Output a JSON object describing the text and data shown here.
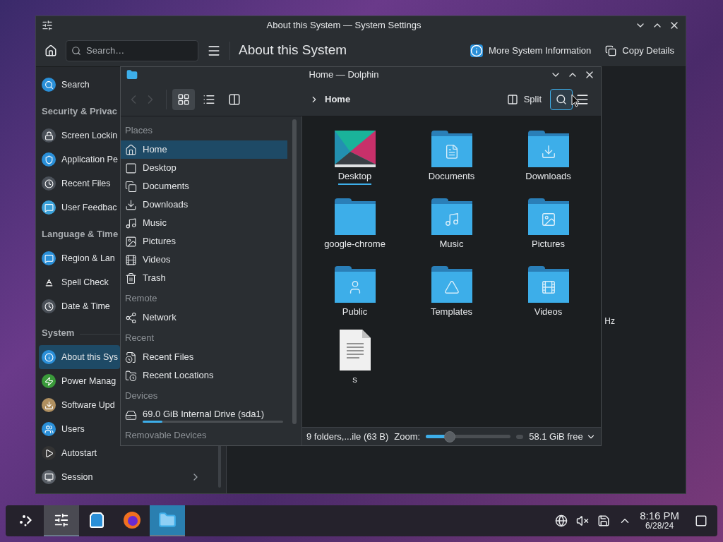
{
  "settings_window": {
    "title": "About this System — System Settings",
    "search": {
      "placeholder": "Search…"
    },
    "page_title": "About this System",
    "actions": [
      "More System Information",
      "Copy Details"
    ],
    "sidebar": [
      {
        "kind": "item",
        "label": "Search",
        "selected": false,
        "submenu": false
      },
      {
        "kind": "header",
        "label": "Security & Privac"
      },
      {
        "kind": "item",
        "label": "Screen Lockin",
        "selected": false,
        "submenu": false
      },
      {
        "kind": "item",
        "label": "Application Pe",
        "selected": false,
        "submenu": false
      },
      {
        "kind": "item",
        "label": "Recent Files",
        "selected": false,
        "submenu": false
      },
      {
        "kind": "item",
        "label": "User Feedbac",
        "selected": false,
        "submenu": false
      },
      {
        "kind": "header",
        "label": "Language & Time"
      },
      {
        "kind": "item",
        "label": "Region & Lan",
        "selected": false,
        "submenu": false
      },
      {
        "kind": "item",
        "label": "Spell Check",
        "selected": false,
        "submenu": false
      },
      {
        "kind": "item",
        "label": "Date & Time",
        "selected": false,
        "submenu": false
      },
      {
        "kind": "header",
        "label": "System"
      },
      {
        "kind": "item",
        "label": "About this Sys",
        "selected": true,
        "submenu": false
      },
      {
        "kind": "item",
        "label": "Power Manag",
        "selected": false,
        "submenu": false
      },
      {
        "kind": "item",
        "label": "Software Upd",
        "selected": false,
        "submenu": false
      },
      {
        "kind": "item",
        "label": "Users",
        "selected": false,
        "submenu": false
      },
      {
        "kind": "item",
        "label": "Autostart",
        "selected": false,
        "submenu": false
      },
      {
        "kind": "item",
        "label": "Session",
        "selected": false,
        "submenu": true
      }
    ],
    "content_fragment": "Hz"
  },
  "dolphin": {
    "title": "Home — Dolphin",
    "view_modes": [
      {
        "selected": true
      },
      {
        "selected": false
      },
      {
        "selected": false
      }
    ],
    "breadcrumb": "Home",
    "split": "Split",
    "search_highlighted": true,
    "places": [
      {
        "kind": "header",
        "label": "Places"
      },
      {
        "kind": "item",
        "label": "Home",
        "selected": true
      },
      {
        "kind": "item",
        "label": "Desktop",
        "selected": false
      },
      {
        "kind": "item",
        "label": "Documents",
        "selected": false
      },
      {
        "kind": "item",
        "label": "Downloads",
        "selected": false
      },
      {
        "kind": "item",
        "label": "Music",
        "selected": false
      },
      {
        "kind": "item",
        "label": "Pictures",
        "selected": false
      },
      {
        "kind": "item",
        "label": "Videos",
        "selected": false
      },
      {
        "kind": "item",
        "label": "Trash",
        "selected": false
      },
      {
        "kind": "header",
        "label": "Remote"
      },
      {
        "kind": "item",
        "label": "Network",
        "selected": false
      },
      {
        "kind": "header",
        "label": "Recent"
      },
      {
        "kind": "item",
        "label": "Recent Files",
        "selected": false
      },
      {
        "kind": "item",
        "label": "Recent Locations",
        "selected": false
      },
      {
        "kind": "header",
        "label": "Devices"
      },
      {
        "kind": "drive",
        "label": "69.0 GiB Internal Drive (sda1)",
        "selected": false,
        "level": 0.14
      },
      {
        "kind": "header",
        "label": "Removable Devices"
      }
    ],
    "files": [
      {
        "kind": "image",
        "name": "Desktop",
        "focused": true
      },
      {
        "kind": "folder",
        "name": "Documents",
        "focused": false
      },
      {
        "kind": "folder",
        "name": "Downloads",
        "focused": false
      },
      {
        "kind": "folder",
        "name": "google-chrome",
        "focused": false
      },
      {
        "kind": "folder",
        "name": "Music",
        "focused": false
      },
      {
        "kind": "folder",
        "name": "Pictures",
        "focused": false
      },
      {
        "kind": "folder",
        "name": "Public",
        "focused": false
      },
      {
        "kind": "folder",
        "name": "Templates",
        "focused": false
      },
      {
        "kind": "folder",
        "name": "Videos",
        "focused": false
      },
      {
        "kind": "text",
        "name": "s",
        "focused": false
      }
    ],
    "status": "9 folders,...ile (63 B)",
    "zoom_label": "Zoom:",
    "zoom": {
      "level": 0.28
    },
    "free": "58.1 GiB free"
  },
  "taskbar": {
    "tasks": [
      {
        "running": false,
        "active": false
      },
      {
        "running": true,
        "active": false
      },
      {
        "running": false,
        "active": false
      },
      {
        "running": false,
        "active": false
      },
      {
        "running": true,
        "active": true
      }
    ],
    "time": "8:16 PM",
    "date": "6/28/24"
  }
}
